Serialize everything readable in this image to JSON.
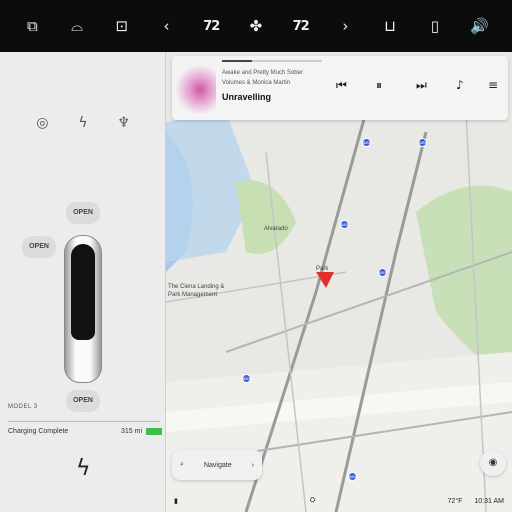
{
  "dock": {
    "items": [
      {
        "name": "rear-defrost",
        "glyph": "⧉"
      },
      {
        "name": "front-defrost",
        "glyph": "⌓"
      },
      {
        "name": "seat-heater-left",
        "glyph": "⊡"
      },
      {
        "name": "temp-down",
        "glyph": "‹"
      },
      {
        "name": "temp-left",
        "glyph": "72"
      },
      {
        "name": "fan",
        "glyph": "✤"
      },
      {
        "name": "temp-right",
        "glyph": "72"
      },
      {
        "name": "temp-up",
        "glyph": "›"
      },
      {
        "name": "seat-heater-right",
        "glyph": "⊔"
      },
      {
        "name": "phone",
        "glyph": "▯"
      },
      {
        "name": "volume",
        "glyph": "🔊"
      }
    ]
  },
  "car": {
    "open_front": "OPEN",
    "open_rear": "OPEN",
    "open_charge": "OPEN",
    "model": "MODEL 3",
    "charge_status": "Charging Complete",
    "range": "315 mi"
  },
  "media": {
    "title": "Unravelling",
    "line2": "Volumes & Monica Martin",
    "line3": "Awake and Pretty Much Sober",
    "progress": 0.3
  },
  "map": {
    "labels": {
      "place1": "The Ciena Landing &",
      "place2": "Park Management",
      "place3": "Alvarado",
      "place4": "Park"
    },
    "navigate": "Navigate"
  },
  "status": {
    "temp": "72°F",
    "time": "10:31 AM"
  },
  "colors": {
    "accent_blue": "#3b5fd0",
    "battery_green": "#3ebd4c",
    "nav_pin": "#e0302c"
  }
}
